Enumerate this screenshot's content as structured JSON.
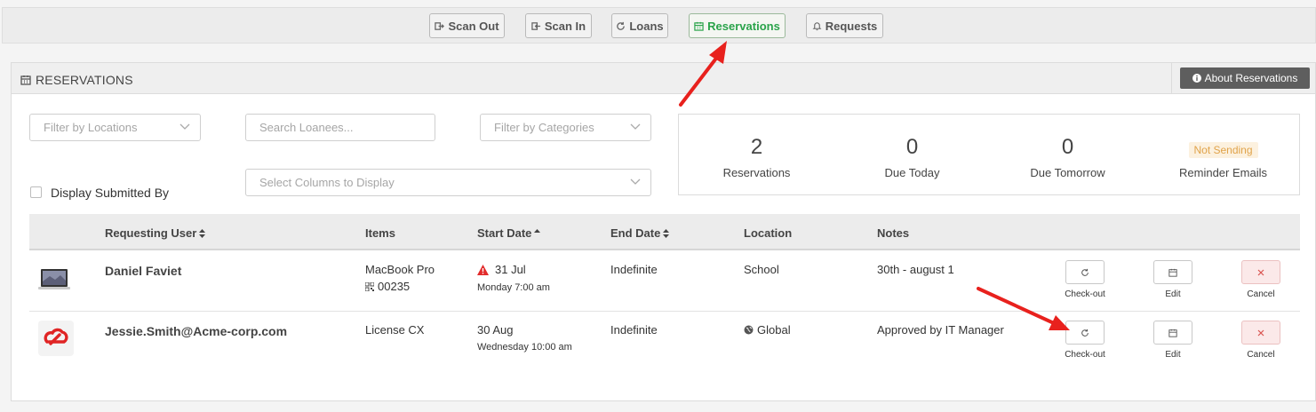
{
  "nav": {
    "items": [
      {
        "label": "Scan Out",
        "icon": "sign-out-icon"
      },
      {
        "label": "Scan In",
        "icon": "sign-in-icon"
      },
      {
        "label": "Loans",
        "icon": "refresh-icon"
      },
      {
        "label": "Reservations",
        "icon": "calendar-icon",
        "active": true
      },
      {
        "label": "Requests",
        "icon": "bell-icon"
      }
    ]
  },
  "panel": {
    "title": "RESERVATIONS",
    "about_label": "About Reservations"
  },
  "filters": {
    "locations_placeholder": "Filter by Locations",
    "search_placeholder": "Search Loanees...",
    "categories_placeholder": "Filter by Categories",
    "columns_placeholder": "Select Columns to Display",
    "display_submitted_by": "Display Submitted By"
  },
  "stats": [
    {
      "value": "2",
      "label": "Reservations"
    },
    {
      "value": "0",
      "label": "Due Today"
    },
    {
      "value": "0",
      "label": "Due Tomorrow"
    },
    {
      "badge": "Not Sending",
      "label": "Reminder Emails"
    }
  ],
  "table": {
    "headers": {
      "user": "Requesting User",
      "items": "Items",
      "start": "Start Date",
      "end": "End Date",
      "location": "Location",
      "notes": "Notes"
    },
    "actions": {
      "checkout": "Check-out",
      "edit": "Edit",
      "cancel": "Cancel"
    },
    "rows": [
      {
        "user": "Daniel Faviet",
        "item": "MacBook Pro",
        "item_code": "00235",
        "start": "31 Jul",
        "start_sub": "Monday 7:00 am",
        "end": "Indefinite",
        "location": "School",
        "notes": "30th - august 1"
      },
      {
        "user": "Jessie.Smith@Acme-corp.com",
        "item": "License CX",
        "start": "30 Aug",
        "start_sub": "Wednesday 10:00 am",
        "end": "Indefinite",
        "location": "Global",
        "notes": "Approved by IT Manager"
      }
    ]
  },
  "colors": {
    "accent_green": "#2aa34a",
    "annotation_red": "#e8211d",
    "warning_red": "#e22b2b"
  }
}
